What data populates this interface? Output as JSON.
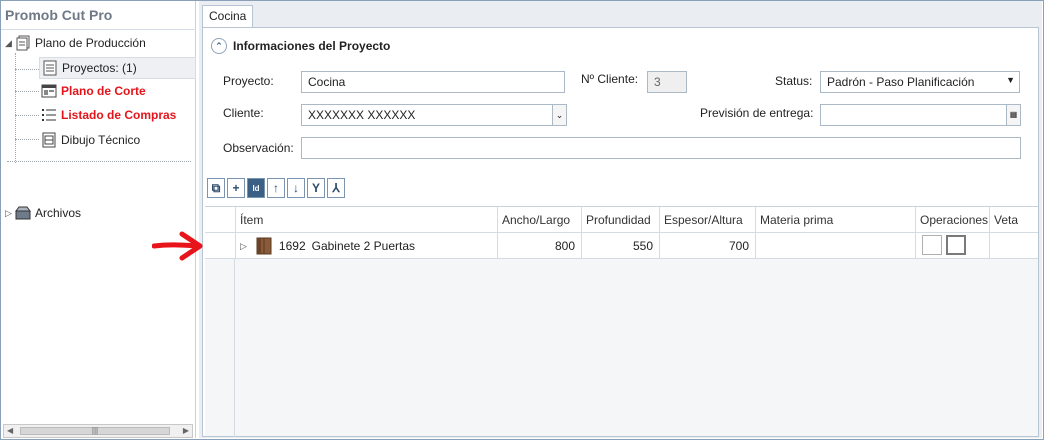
{
  "app": {
    "title": "Promob Cut Pro"
  },
  "sidebar": {
    "items": [
      {
        "label": "Plano de Producción"
      },
      {
        "label": "Proyectos: (1)"
      },
      {
        "label": "Plano de Corte"
      },
      {
        "label": "Listado de Compras"
      },
      {
        "label": "Dibujo Técnico"
      },
      {
        "label": "Archivos"
      }
    ]
  },
  "tabs": [
    {
      "label": "Cocina"
    }
  ],
  "section": {
    "title": "Informaciones del Proyecto"
  },
  "form": {
    "proyecto_label": "Proyecto:",
    "proyecto_value": "Cocina",
    "nro_cliente_label": "Nº Cliente:",
    "nro_cliente_value": "3",
    "status_label": "Status:",
    "status_value": "Padrón - Paso Planificación",
    "cliente_label": "Cliente:",
    "cliente_value": "XXXXXXX XXXXXX",
    "prevision_label": "Previsión de entrega:",
    "prevision_value": "",
    "observacion_label": "Observación:",
    "observacion_value": ""
  },
  "toolbar": {
    "buttons": [
      "expand-all-icon",
      "add-icon",
      "id-icon",
      "move-up-icon",
      "move-down-icon",
      "merge-icon",
      "split-icon"
    ],
    "id_label": "Id"
  },
  "grid": {
    "columns": [
      "Ítem",
      "Ancho/Largo",
      "Profundidad",
      "Espesor/Altura",
      "Materia prima",
      "Operaciones",
      "Veta"
    ],
    "rows": [
      {
        "id": "1692",
        "name": "Gabinete 2 Puertas",
        "ancho": "800",
        "profundidad": "550",
        "espesor": "700",
        "materia": ""
      }
    ]
  },
  "colors": {
    "accent_red": "#e4141b",
    "annotation_arrow": "#e8141b"
  }
}
